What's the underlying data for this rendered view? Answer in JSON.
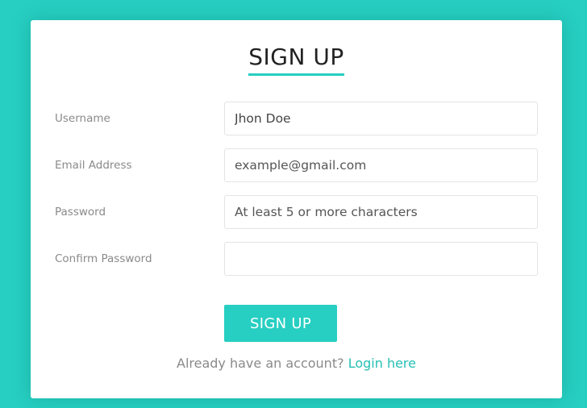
{
  "form": {
    "title": "SIGN UP",
    "fields": [
      {
        "label": "Username",
        "value": "Jhon Doe",
        "placeholder": ""
      },
      {
        "label": "Email Address",
        "value": "",
        "placeholder": "example@gmail.com"
      },
      {
        "label": "Password",
        "value": "",
        "placeholder": "At least 5 or more characters"
      },
      {
        "label": "Confirm Password",
        "value": "",
        "placeholder": ""
      }
    ],
    "submit_label": "SIGN UP",
    "footer_text": "Already have an account?",
    "login_link": "Login here"
  },
  "colors": {
    "background": "#26cfc2",
    "card": "#ffffff",
    "accent": "#26cfc2",
    "link": "#26bfb3"
  }
}
